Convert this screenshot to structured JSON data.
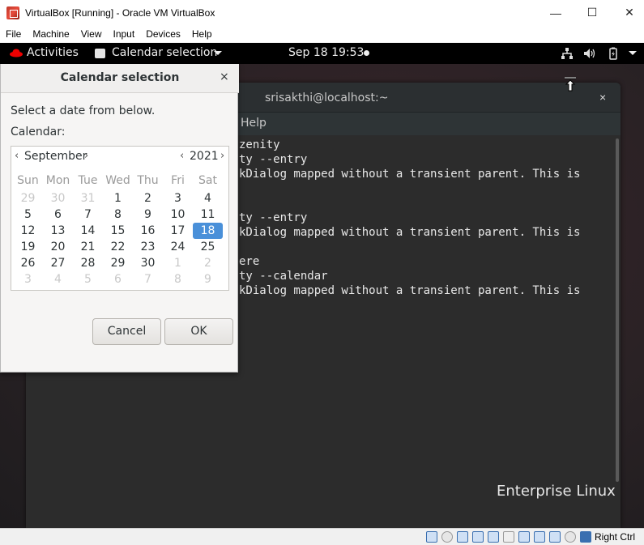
{
  "host": {
    "title": "VirtualBox [Running] - Oracle VM VirtualBox",
    "window_controls": {
      "minimize": "—",
      "maximize": "☐",
      "close": "✕"
    },
    "menu": [
      "File",
      "Machine",
      "View",
      "Input",
      "Devices",
      "Help"
    ],
    "status": {
      "host_key": "Right Ctrl"
    }
  },
  "gnome": {
    "activities": "Activities",
    "app_name": "Calendar selection",
    "clock": "Sep 18  19:53"
  },
  "terminal": {
    "title": "srisakthi@localhost:~",
    "help_menu": "Help",
    "lines": [
      "zenity",
      "ty --entry",
      "kDialog mapped without a transient parent. This is",
      "",
      "ty --entry",
      "kDialog mapped without a transient parent. This is",
      "",
      "ere",
      "ty --calendar",
      "kDialog mapped without a transient parent. This is"
    ],
    "close": "×"
  },
  "desktop": {
    "brand": "Enterprise Linux"
  },
  "dialog": {
    "title": "Calendar selection",
    "close": "×",
    "prompt": "Select a date from below.",
    "calendar_label": "Calendar:",
    "month": "September",
    "year": "2021",
    "prev": "‹",
    "next": "›",
    "weekdays": [
      "Sun",
      "Mon",
      "Tue",
      "Wed",
      "Thu",
      "Fri",
      "Sat"
    ],
    "weeks": [
      [
        "29",
        "30",
        "31",
        "1",
        "2",
        "3",
        "4"
      ],
      [
        "5",
        "6",
        "7",
        "8",
        "9",
        "10",
        "11"
      ],
      [
        "12",
        "13",
        "14",
        "15",
        "16",
        "17",
        "18"
      ],
      [
        "19",
        "20",
        "21",
        "22",
        "23",
        "24",
        "25"
      ],
      [
        "26",
        "27",
        "28",
        "29",
        "30",
        "1",
        "2"
      ],
      [
        "3",
        "4",
        "5",
        "6",
        "7",
        "8",
        "9"
      ]
    ],
    "selected_day": "18",
    "cancel": "Cancel",
    "ok": "OK"
  }
}
